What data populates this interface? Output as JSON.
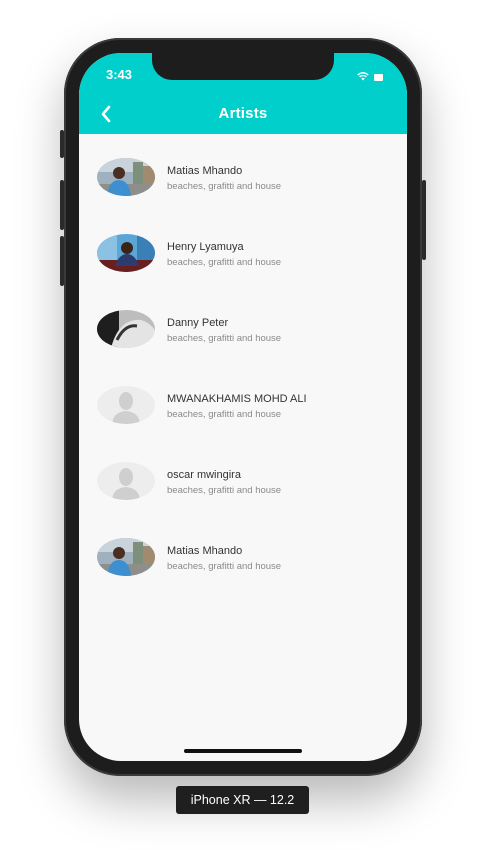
{
  "status_bar": {
    "time": "3:43"
  },
  "app_bar": {
    "title": "Artists"
  },
  "artists": [
    {
      "name": "Matias Mhando",
      "subtitle": "beaches, grafitti and house",
      "avatar": "photo"
    },
    {
      "name": "Henry Lyamuya",
      "subtitle": "beaches, grafitti and house",
      "avatar": "photo"
    },
    {
      "name": "Danny Peter",
      "subtitle": "beaches, grafitti and house",
      "avatar": "photo-bw"
    },
    {
      "name": "MWANAKHAMIS MOHD ALI",
      "subtitle": "beaches, grafitti and house",
      "avatar": "placeholder"
    },
    {
      "name": "oscar mwingira",
      "subtitle": "beaches, grafitti and house",
      "avatar": "placeholder"
    },
    {
      "name": "Matias Mhando",
      "subtitle": "beaches, grafitti and house",
      "avatar": "photo"
    }
  ],
  "device_label": "iPhone XR — 12.2",
  "colors": {
    "accent": "#00cfcc",
    "background": "#f8f8f8"
  },
  "icons": [
    "chevron-left-icon",
    "wifi-icon",
    "battery-icon"
  ]
}
